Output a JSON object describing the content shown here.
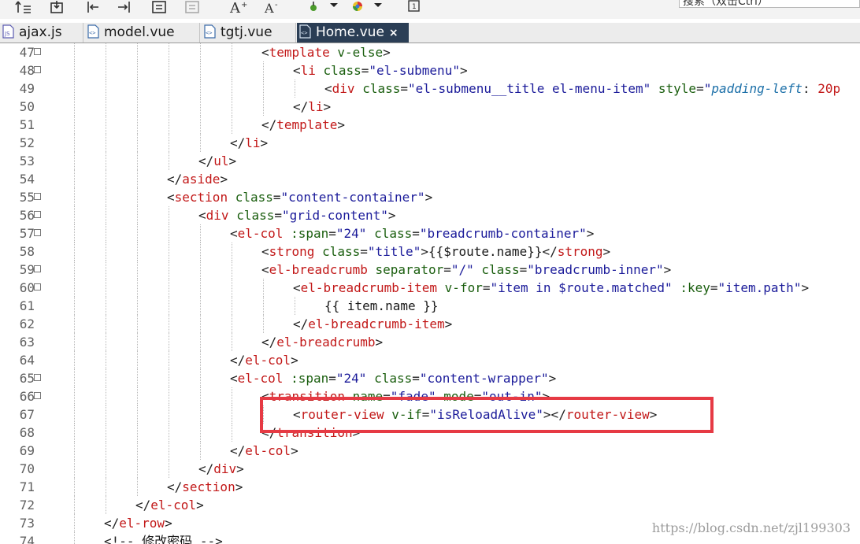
{
  "toolbar": {
    "search_text": "搜索（双击Ctrl）",
    "icons": [
      "indent-icon",
      "export-icon",
      "move-left-icon",
      "move-right-icon",
      "comment-icon",
      "uncomment-icon",
      "font-larger-icon",
      "font-smaller-icon",
      "run-icon",
      "dropdown-icon",
      "browser-icon",
      "dropdown-icon",
      "info-icon"
    ]
  },
  "tabs": [
    {
      "label": "ajax.js",
      "type": "js"
    },
    {
      "label": "model.vue",
      "type": "vue"
    },
    {
      "label": "tgtj.vue",
      "type": "vue"
    },
    {
      "label": "Home.vue",
      "type": "vue",
      "active": true,
      "close": "×"
    }
  ],
  "watermark": "https://blog.csdn.net/zjl199303",
  "colors": {
    "tag": "#c21818",
    "attr": "#1a5e0e",
    "string": "#1b1b9a",
    "highlight": "#e63a44",
    "active_tab": "#2b3e55"
  },
  "lines": [
    {
      "n": "47",
      "fold": true,
      "indent": 7,
      "t": [
        [
          "br",
          "<"
        ],
        [
          "tag",
          "template"
        ],
        [
          "txt",
          " "
        ],
        [
          "attr",
          "v-else"
        ],
        [
          "br",
          ">"
        ]
      ]
    },
    {
      "n": "48",
      "fold": true,
      "indent": 8,
      "t": [
        [
          "br",
          "<"
        ],
        [
          "tag",
          "li"
        ],
        [
          "txt",
          " "
        ],
        [
          "attr",
          "class"
        ],
        [
          "br",
          "="
        ],
        [
          "str",
          "\"el-submenu\""
        ],
        [
          "br",
          ">"
        ]
      ]
    },
    {
      "n": "49",
      "fold": false,
      "indent": 9,
      "t": [
        [
          "br",
          "<"
        ],
        [
          "tag",
          "div"
        ],
        [
          "txt",
          " "
        ],
        [
          "attr",
          "class"
        ],
        [
          "br",
          "="
        ],
        [
          "str",
          "\"el-submenu__title el-menu-item\""
        ],
        [
          "txt",
          " "
        ],
        [
          "attr",
          "style"
        ],
        [
          "br",
          "="
        ],
        [
          "str",
          "\""
        ],
        [
          "css",
          "padding-left"
        ],
        [
          "br",
          ": "
        ],
        [
          "tag",
          "20p"
        ]
      ]
    },
    {
      "n": "50",
      "fold": false,
      "indent": 8,
      "t": [
        [
          "br",
          "</"
        ],
        [
          "tag",
          "li"
        ],
        [
          "br",
          ">"
        ]
      ]
    },
    {
      "n": "51",
      "fold": false,
      "indent": 7,
      "t": [
        [
          "br",
          "</"
        ],
        [
          "tag",
          "template"
        ],
        [
          "br",
          ">"
        ]
      ]
    },
    {
      "n": "52",
      "fold": false,
      "indent": 6,
      "t": [
        [
          "br",
          "</"
        ],
        [
          "tag",
          "li"
        ],
        [
          "br",
          ">"
        ]
      ]
    },
    {
      "n": "53",
      "fold": false,
      "indent": 5,
      "t": [
        [
          "br",
          "</"
        ],
        [
          "tag",
          "ul"
        ],
        [
          "br",
          ">"
        ]
      ]
    },
    {
      "n": "54",
      "fold": false,
      "indent": 4,
      "t": [
        [
          "br",
          "</"
        ],
        [
          "tag",
          "aside"
        ],
        [
          "br",
          ">"
        ]
      ]
    },
    {
      "n": "55",
      "fold": true,
      "indent": 4,
      "t": [
        [
          "br",
          "<"
        ],
        [
          "tag",
          "section"
        ],
        [
          "txt",
          " "
        ],
        [
          "attr",
          "class"
        ],
        [
          "br",
          "="
        ],
        [
          "str",
          "\"content-container\""
        ],
        [
          "br",
          ">"
        ]
      ]
    },
    {
      "n": "56",
      "fold": true,
      "indent": 5,
      "t": [
        [
          "br",
          "<"
        ],
        [
          "tag",
          "div"
        ],
        [
          "txt",
          " "
        ],
        [
          "attr",
          "class"
        ],
        [
          "br",
          "="
        ],
        [
          "str",
          "\"grid-content\""
        ],
        [
          "br",
          ">"
        ]
      ]
    },
    {
      "n": "57",
      "fold": true,
      "indent": 6,
      "t": [
        [
          "br",
          "<"
        ],
        [
          "tag",
          "el-col"
        ],
        [
          "txt",
          " "
        ],
        [
          "attr",
          ":span"
        ],
        [
          "br",
          "="
        ],
        [
          "str",
          "\"24\""
        ],
        [
          "txt",
          " "
        ],
        [
          "attr",
          "class"
        ],
        [
          "br",
          "="
        ],
        [
          "str",
          "\"breadcrumb-container\""
        ],
        [
          "br",
          ">"
        ]
      ]
    },
    {
      "n": "58",
      "fold": false,
      "indent": 7,
      "t": [
        [
          "br",
          "<"
        ],
        [
          "tag",
          "strong"
        ],
        [
          "txt",
          " "
        ],
        [
          "attr",
          "class"
        ],
        [
          "br",
          "="
        ],
        [
          "str",
          "\"title\""
        ],
        [
          "br",
          ">"
        ],
        [
          "txt",
          "{{$route.name}}"
        ],
        [
          "br",
          "</"
        ],
        [
          "tag",
          "strong"
        ],
        [
          "br",
          ">"
        ]
      ]
    },
    {
      "n": "59",
      "fold": true,
      "indent": 7,
      "t": [
        [
          "br",
          "<"
        ],
        [
          "tag",
          "el-breadcrumb"
        ],
        [
          "txt",
          " "
        ],
        [
          "attr",
          "separator"
        ],
        [
          "br",
          "="
        ],
        [
          "str",
          "\"/\""
        ],
        [
          "txt",
          " "
        ],
        [
          "attr",
          "class"
        ],
        [
          "br",
          "="
        ],
        [
          "str",
          "\"breadcrumb-inner\""
        ],
        [
          "br",
          ">"
        ]
      ]
    },
    {
      "n": "60",
      "fold": true,
      "indent": 8,
      "t": [
        [
          "br",
          "<"
        ],
        [
          "tag",
          "el-breadcrumb-item"
        ],
        [
          "txt",
          " "
        ],
        [
          "attr",
          "v-for"
        ],
        [
          "br",
          "="
        ],
        [
          "str",
          "\"item in $route.matched\""
        ],
        [
          "txt",
          " "
        ],
        [
          "attr",
          ":key"
        ],
        [
          "br",
          "="
        ],
        [
          "str",
          "\"item.path\""
        ],
        [
          "br",
          ">"
        ]
      ]
    },
    {
      "n": "61",
      "fold": false,
      "indent": 9,
      "t": [
        [
          "txt",
          "{{ item.name }}"
        ]
      ]
    },
    {
      "n": "62",
      "fold": false,
      "indent": 8,
      "t": [
        [
          "br",
          "</"
        ],
        [
          "tag",
          "el-breadcrumb-item"
        ],
        [
          "br",
          ">"
        ]
      ]
    },
    {
      "n": "63",
      "fold": false,
      "indent": 7,
      "t": [
        [
          "br",
          "</"
        ],
        [
          "tag",
          "el-breadcrumb"
        ],
        [
          "br",
          ">"
        ]
      ]
    },
    {
      "n": "64",
      "fold": false,
      "indent": 6,
      "t": [
        [
          "br",
          "</"
        ],
        [
          "tag",
          "el-col"
        ],
        [
          "br",
          ">"
        ]
      ]
    },
    {
      "n": "65",
      "fold": true,
      "indent": 6,
      "t": [
        [
          "br",
          "<"
        ],
        [
          "tag",
          "el-col"
        ],
        [
          "txt",
          " "
        ],
        [
          "attr",
          ":span"
        ],
        [
          "br",
          "="
        ],
        [
          "str",
          "\"24\""
        ],
        [
          "txt",
          " "
        ],
        [
          "attr",
          "class"
        ],
        [
          "br",
          "="
        ],
        [
          "str",
          "\"content-wrapper\""
        ],
        [
          "br",
          ">"
        ]
      ]
    },
    {
      "n": "66",
      "fold": true,
      "indent": 7,
      "t": [
        [
          "br",
          "<"
        ],
        [
          "tag",
          "transition"
        ],
        [
          "txt",
          " "
        ],
        [
          "attr",
          "name"
        ],
        [
          "br",
          "="
        ],
        [
          "str",
          "\"fade\""
        ],
        [
          "txt",
          " "
        ],
        [
          "attr",
          "mode"
        ],
        [
          "br",
          "="
        ],
        [
          "str",
          "\"out-in\""
        ],
        [
          "br",
          ">"
        ]
      ]
    },
    {
      "n": "67",
      "fold": false,
      "indent": 8,
      "t": [
        [
          "br",
          "<"
        ],
        [
          "tag",
          "router-view"
        ],
        [
          "txt",
          " "
        ],
        [
          "attr",
          "v-if"
        ],
        [
          "br",
          "="
        ],
        [
          "str",
          "\"isReloadAlive\""
        ],
        [
          "br",
          "></"
        ],
        [
          "tag",
          "router-view"
        ],
        [
          "br",
          ">"
        ]
      ]
    },
    {
      "n": "68",
      "fold": false,
      "indent": 7,
      "t": [
        [
          "br",
          "</"
        ],
        [
          "tag",
          "transition"
        ],
        [
          "br",
          ">"
        ]
      ]
    },
    {
      "n": "69",
      "fold": false,
      "indent": 6,
      "t": [
        [
          "br",
          "</"
        ],
        [
          "tag",
          "el-col"
        ],
        [
          "br",
          ">"
        ]
      ]
    },
    {
      "n": "70",
      "fold": false,
      "indent": 5,
      "t": [
        [
          "br",
          "</"
        ],
        [
          "tag",
          "div"
        ],
        [
          "br",
          ">"
        ]
      ]
    },
    {
      "n": "71",
      "fold": false,
      "indent": 4,
      "t": [
        [
          "br",
          "</"
        ],
        [
          "tag",
          "section"
        ],
        [
          "br",
          ">"
        ]
      ]
    },
    {
      "n": "72",
      "fold": false,
      "indent": 3,
      "t": [
        [
          "br",
          "</"
        ],
        [
          "tag",
          "el-col"
        ],
        [
          "br",
          ">"
        ]
      ]
    },
    {
      "n": "73",
      "fold": false,
      "indent": 2,
      "t": [
        [
          "br",
          "</"
        ],
        [
          "tag",
          "el-row"
        ],
        [
          "br",
          ">"
        ]
      ]
    },
    {
      "n": "74",
      "fold": false,
      "indent": 2,
      "t": [
        [
          "br",
          "<!-- "
        ],
        [
          "txt",
          "修改密码"
        ],
        [
          "br",
          " -->"
        ]
      ]
    }
  ]
}
